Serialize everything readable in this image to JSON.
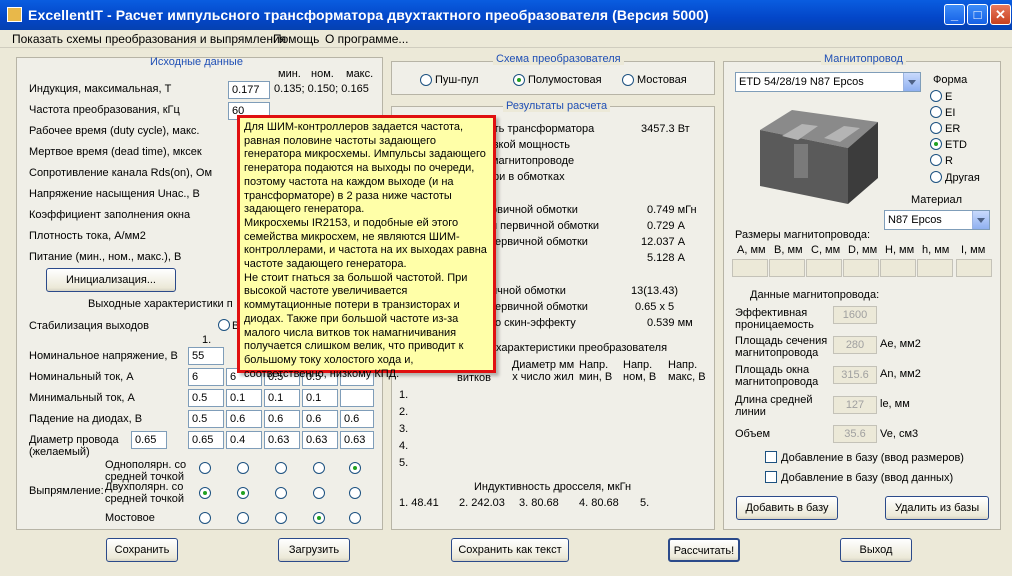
{
  "window": {
    "title": "ExcellentIT - Расчет импульсного трансформатора двухтактного преобразователя (Версия 5000)",
    "min": "_",
    "max": "□",
    "close": "✕"
  },
  "menu": [
    "Показать схемы преобразования и выпрямления",
    "Помощь",
    "О программе..."
  ],
  "input": {
    "title": "Исходные данные",
    "range_header": [
      "мин.",
      "ном.",
      "макс."
    ],
    "range_values": "0.135; 0.150; 0.165",
    "labels": [
      "Индукция, максимальная, Т",
      "Частота преобразования, кГц",
      "Рабочее время (duty cycle), макс.",
      "Мертвое время (dead time), мксек",
      "Сопротивление канала Rds(on), Ом",
      "Напряжение насыщения Uнас., В",
      "Коэффициент заполнения окна",
      "Плотность тока, А/мм2",
      "Питание (мин., ном., макс.), В"
    ],
    "values": [
      "0.177",
      "60"
    ],
    "init_button": "Инициализация..."
  },
  "output": {
    "title": "Выходные характеристики п",
    "stab_label": "Стабилизация выходов",
    "stab_radio": "В",
    "col1": "1.",
    "rows": [
      {
        "label": "Номинальное напряжение, В",
        "vals": [
          "55",
          "",
          "",
          "",
          ""
        ]
      },
      {
        "label": "Номинальный ток, А",
        "vals": [
          "6",
          "6",
          "0.5",
          "0.5",
          ""
        ]
      },
      {
        "label": "Минимальный ток, А",
        "vals": [
          "0.5",
          "0.1",
          "0.1",
          "0.1",
          ""
        ]
      },
      {
        "label": "Падение на диодах, В",
        "vals": [
          "0.5",
          "0.6",
          "0.6",
          "0.6",
          "0.6"
        ]
      },
      {
        "label": "Диаметр провода (желаемый)",
        "vals": [
          "0.65",
          "0.4",
          "0.63",
          "0.63",
          "0.63"
        ]
      }
    ],
    "desired_dia": "0.65",
    "rect_label": "Выпрямление:",
    "rect_options": [
      "Однополярн. со средней точкой",
      "Двухполярн. со средней точкой",
      "Мостовое"
    ],
    "rect_selection": [
      5,
      2,
      4,
      2
    ]
  },
  "scheme": {
    "title": "Схема преобразователя",
    "options": [
      "Пуш-пул",
      "Полумостовая",
      "Мостовая"
    ],
    "selected": 1
  },
  "results": {
    "title": "Результаты расчета",
    "lines": [
      {
        "label": "ость трансформатора",
        "value": "3457.3 Вт"
      },
      {
        "label": "рузкой мощность",
        "value": ""
      },
      {
        "label": "в магнитопроводе",
        "value": ""
      },
      {
        "label": "тери в обмотках",
        "value": ""
      },
      {
        "label": "рвичной обмотки",
        "value": "0.749 мГн"
      },
      {
        "label": "ия первичной обмотки",
        "value": "0.729 А"
      },
      {
        "label": "первичной обмотки",
        "value": "12.037 А"
      },
      {
        "label": "",
        "value": "5.128 А"
      },
      {
        "label": "ичной обмотки",
        "value": "13(13.43)"
      },
      {
        "label": "первичной обмотки",
        "value": "0.65 x 5"
      },
      {
        "label": "по скин-эффекту",
        "value": "0.539 мм"
      }
    ],
    "sec_title": "характеристики преобразователя",
    "sec_headers": [
      "витков",
      "Диаметр мм x число жил",
      "Напр. мин, В",
      "Напр. ном, В",
      "Напр. макс, В"
    ],
    "sec_rows": [
      "1.",
      "2.",
      "3.",
      "4.",
      "5."
    ],
    "choke_title": "Индуктивность дросселя, мкГн",
    "choke_values": [
      "1. 48.41",
      "2. 242.03",
      "3. 80.68",
      "4. 80.68",
      "5."
    ]
  },
  "core": {
    "title": "Магнитопровод",
    "selected_core": "ETD 54/28/19 N87 Epcos",
    "form_label": "Форма",
    "forms": [
      "E",
      "EI",
      "ER",
      "ETD",
      "R",
      "Другая"
    ],
    "form_selected": 3,
    "material_label": "Материал",
    "material": "N87 Epcos",
    "size_title": "Размеры магнитопровода:",
    "size_headers": [
      "A, мм",
      "B, мм",
      "C, мм",
      "D, мм",
      "H, мм",
      "h, мм",
      "I, мм"
    ],
    "data_title": "Данные магнитопровода:",
    "params": [
      {
        "label": "Эффективная проницаемость",
        "value": "1600",
        "unit": ""
      },
      {
        "label": "Площадь сечения магнитопровода",
        "value": "280",
        "unit": "Ae, мм2"
      },
      {
        "label": "Площадь окна магнитопровода",
        "value": "315.6",
        "unit": "An, мм2"
      },
      {
        "label": "Длина средней линии",
        "value": "127",
        "unit": "le, мм"
      },
      {
        "label": "Объем",
        "value": "35.6",
        "unit": "Ve, см3"
      }
    ],
    "check1": "Добавление в базу (ввод размеров)",
    "check2": "Добавление в базу (ввод данных)",
    "add_button": "Добавить в базу",
    "del_button": "Удалить из базы"
  },
  "bottom_buttons": {
    "save": "Сохранить",
    "load": "Загрузить",
    "save_text": "Сохранить как текст",
    "calc": "Рассчитать!",
    "exit": "Выход"
  },
  "tooltip": "Для ШИМ-контроллеров задается частота, равная половине частоты задающего генератора микросхемы. Импульсы задающего генератора подаются на выходы по очереди, поэтому частота на каждом выходе (и на трансформаторе) в 2 раза ниже частоты задающего генератора.\nМикросхемы IR2153, и подобные ей этого семейства микросхем, не являются ШИМ-контроллерами, и частота на их выходах равна частоте задающего генератора.\nНе стоит гнаться за большой частотой. При высокой частоте увеличивается коммутационные потери в транзисторах и диодах. Также при большой частоте из-за малого числа витков ток намагничивания получается слишком велик, что приводит к большому току холостого хода и, соответственно, низкому КПД."
}
